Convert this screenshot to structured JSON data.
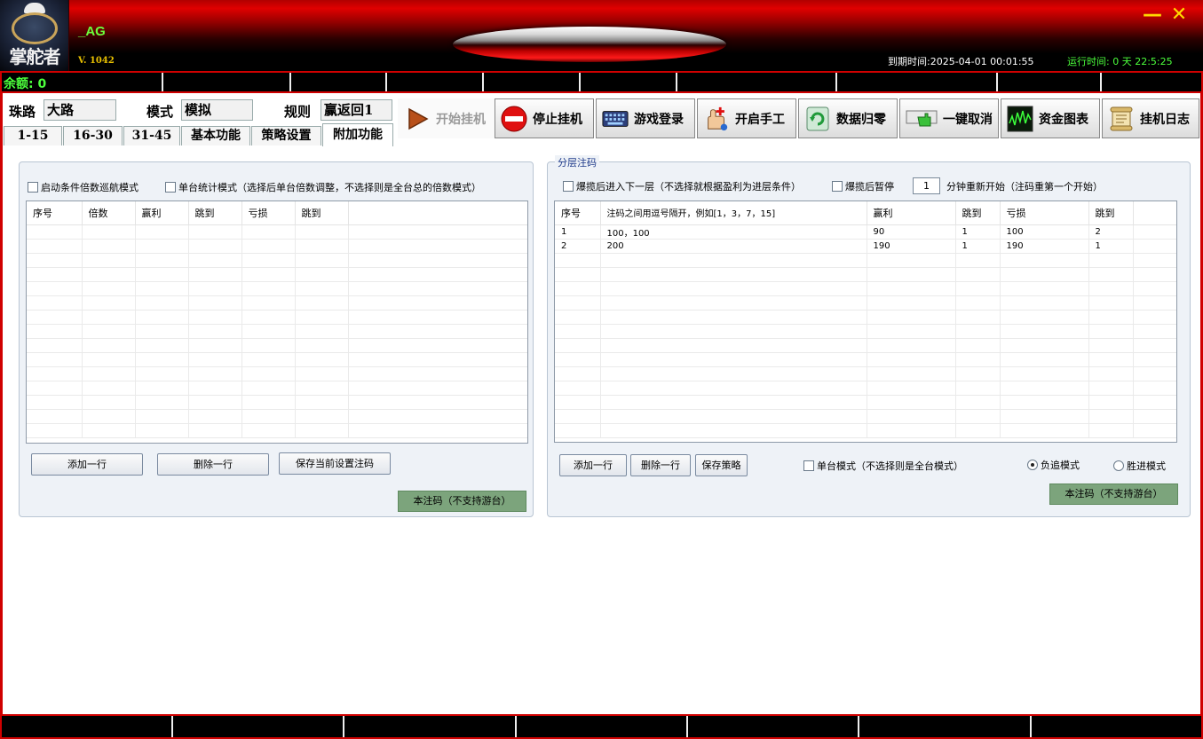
{
  "title": {
    "logo_brand": "掌舵者",
    "app_name": "_AG",
    "version": "V. 1042",
    "expire": "到期时间:2025-04-01 00:01:55",
    "runtime": "运行时间: 0 天 22:5:25",
    "minimize": "—",
    "close": "✕"
  },
  "status": {
    "balance": "余额: 0"
  },
  "fields": [
    {
      "label": "珠路",
      "value": "大路"
    },
    {
      "label": "模式",
      "value": "模拟"
    },
    {
      "label": "规则",
      "value": "赢返回1"
    }
  ],
  "tabs": [
    "1-15",
    "16-30",
    "31-45",
    "基本功能",
    "策略设置",
    "附加功能"
  ],
  "active_tab": "附加功能",
  "toolbar": [
    {
      "label": "开始挂机",
      "icon": "play-icon",
      "enabled": false
    },
    {
      "label": "停止挂机",
      "icon": "stop-icon",
      "enabled": true
    },
    {
      "label": "游戏登录",
      "icon": "keyboard-icon",
      "enabled": true
    },
    {
      "label": "开启手工",
      "icon": "hand-icon",
      "enabled": true
    },
    {
      "label": "数据归零",
      "icon": "refresh-icon",
      "enabled": true
    },
    {
      "label": "一键取消",
      "icon": "pointer-icon",
      "enabled": true
    },
    {
      "label": "资金图表",
      "icon": "chart-icon",
      "enabled": true
    },
    {
      "label": "挂机日志",
      "icon": "scroll-icon",
      "enabled": true
    }
  ],
  "left": {
    "cb_cruise": "启动条件倍数巡航模式",
    "cb_single": "单台统计模式（选择后单台倍数调整，不选择则是全台总的倍数模式）",
    "columns": [
      "序号",
      "倍数",
      "赢利",
      "跳到",
      "亏损",
      "跳到"
    ],
    "rows": [],
    "btn_add": "添加一行",
    "btn_delete": "删除一行",
    "btn_save": "保存当前设置注码",
    "btn_bet": "本注码（不支持游台）"
  },
  "right": {
    "legend": "分层注码",
    "cb_next": "爆揽后进入下一层（不选择就根据盈利为进层条件）",
    "cb_pause": "爆揽后暂停",
    "pause_minutes": "1",
    "restart_text": "分钟重新开始（注码重第一个开始）",
    "columns": [
      "序号",
      "注码之间用逗号隔开，例如[1，3，7，15]",
      "赢利",
      "跳到",
      "亏损",
      "跳到"
    ],
    "rows": [
      [
        "1",
        "100，100",
        "90",
        "1",
        "100",
        "2"
      ],
      [
        "2",
        "200",
        "190",
        "1",
        "190",
        "1"
      ]
    ],
    "btn_add": "添加一行",
    "btn_delete": "删除一行",
    "btn_save": "保存策略",
    "cb_single": "单台模式（不选择则是全台模式）",
    "radio_neg": "负追模式",
    "radio_pos": "胜进模式",
    "selected_mode": "负追模式",
    "btn_bet": "本注码（不支持游台）"
  }
}
